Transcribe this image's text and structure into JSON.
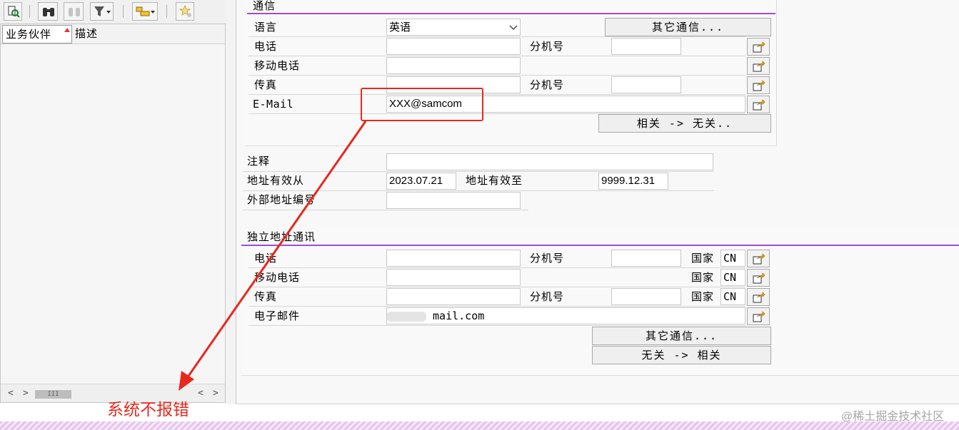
{
  "left_panel": {
    "columns": [
      "业务伙伴",
      "描述"
    ],
    "scroll_left": "<",
    "scroll_right": ">",
    "scroll_thumb": "III",
    "scroll_left_2": "<",
    "scroll_right_2": ">"
  },
  "comm_section": {
    "title": "通信",
    "language_label": "语言",
    "language_value": "英语",
    "other_comm_button": "其它通信...",
    "phone_label": "电话",
    "phone_value": "",
    "ext_label_1": "分机号",
    "ext_value_1": "",
    "mobile_label": "移动电话",
    "mobile_value": "",
    "fax_label": "传真",
    "fax_value": "",
    "ext_label_2": "分机号",
    "ext_value_2": "",
    "email_label": "E-Mail",
    "email_value": "XXX@samcom",
    "relation_button": "相关 -> 无关.."
  },
  "addr_section": {
    "note_label": "注释",
    "note_value": "",
    "valid_from_label": "地址有效从",
    "valid_from_value": "2023.07.21",
    "valid_to_label": "地址有效至",
    "valid_to_value": "9999.12.31",
    "ext_addr_label": "外部地址编号",
    "ext_addr_value": ""
  },
  "indep_section": {
    "title": "独立地址通讯",
    "phone_label": "电话",
    "ext_label_1": "分机号",
    "country_label_1": "国家",
    "country_value_1": "CN",
    "mobile_label": "移动电话",
    "country_label_2": "国家",
    "country_value_2": "CN",
    "fax_label": "传真",
    "ext_label_2": "分机号",
    "country_label_3": "国家",
    "country_value_3": "CN",
    "email_label": "电子邮件",
    "email_value": "mail.com",
    "other_comm_button": "其它通信...",
    "relation_button": "无关 -> 相关"
  },
  "annotation": {
    "text": "系统不报错",
    "color": "#e8281e"
  },
  "watermark": "@稀土掘金技术社区",
  "colors": {
    "accent_line": "#a24ad6",
    "highlight": "#e8281e"
  }
}
